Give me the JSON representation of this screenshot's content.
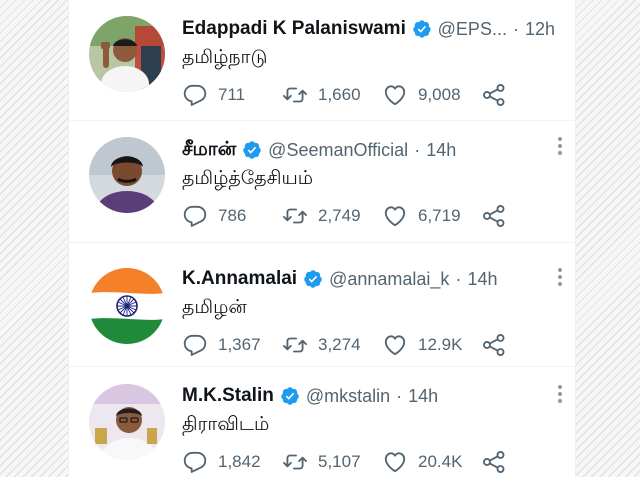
{
  "tweets": [
    {
      "name": "Edappadi K Palaniswami",
      "handle": "@EPS...",
      "time": "12h",
      "text": "தமிழ்நாடு",
      "replies": "711",
      "retweets": "1,660",
      "likes": "9,008"
    },
    {
      "name": "சீமான்",
      "handle": "@SeemanOfficial",
      "time": "14h",
      "text": "தமிழ்த்தேசியம்",
      "replies": "786",
      "retweets": "2,749",
      "likes": "6,719"
    },
    {
      "name": "K.Annamalai",
      "handle": "@annamalai_k",
      "time": "14h",
      "text": "தமிழன்",
      "replies": "1,367",
      "retweets": "3,274",
      "likes": "12.9K"
    },
    {
      "name": "M.K.Stalin",
      "handle": "@mkstalin",
      "time": "14h",
      "text": "திராவிடம்",
      "replies": "1,842",
      "retweets": "5,107",
      "likes": "20.4K"
    }
  ],
  "separator": "·",
  "colors": {
    "verified": "#1d9bf0",
    "name": "#0f1419",
    "secondary": "#536471",
    "flag_saffron": "#f4802a",
    "flag_green": "#1f8a3a",
    "chakra": "#1a237e"
  },
  "icons": [
    "verified-badge-icon",
    "reply-icon",
    "retweet-icon",
    "like-icon",
    "share-icon",
    "more-icon"
  ]
}
